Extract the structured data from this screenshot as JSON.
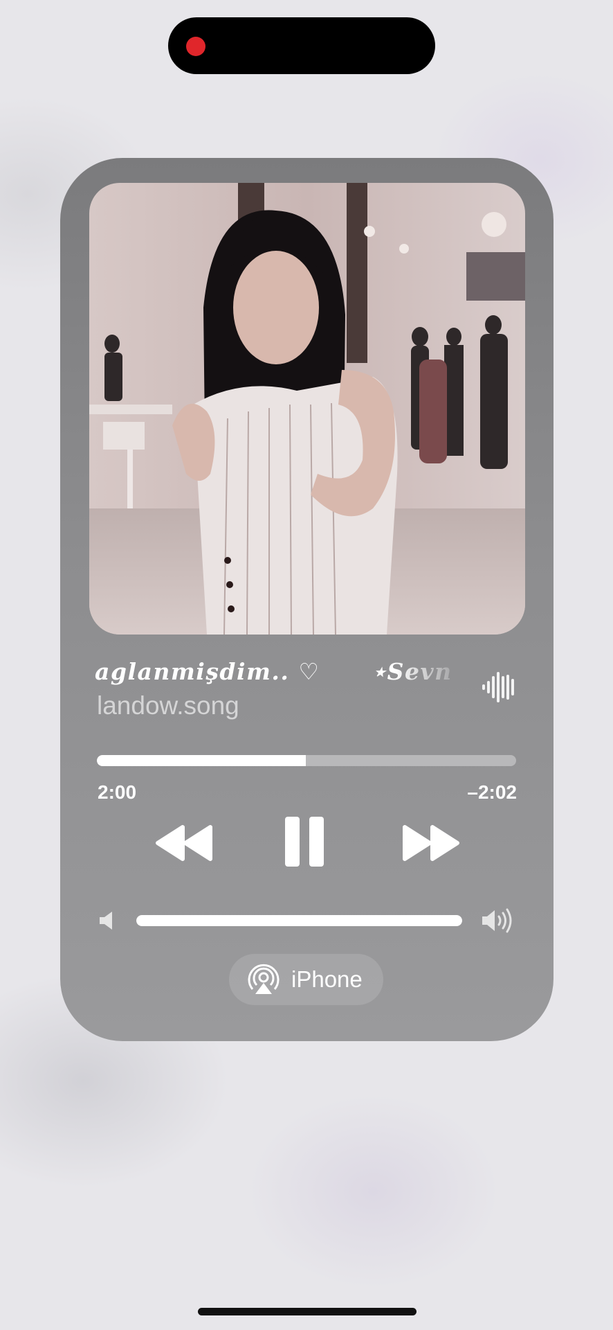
{
  "now_playing": {
    "title_primary": "aglanmişdim..",
    "title_heart": "♡",
    "title_secondary": "⋆Sevn",
    "artist": "landow.song",
    "artwork_icon": "music-video-artwork",
    "elapsed": "2:00",
    "remaining": "–2:02",
    "progress_fraction": 0.498,
    "is_playing": true
  },
  "controls": {
    "rewind_icon": "backward-icon",
    "pause_icon": "pause-icon",
    "forward_icon": "forward-icon"
  },
  "volume": {
    "level_fraction": 1.0,
    "low_icon": "speaker-low-icon",
    "high_icon": "speaker-high-icon"
  },
  "output": {
    "label": "iPhone",
    "icon": "airplay-icon"
  },
  "status": {
    "recording_indicator": "recording-dot"
  },
  "colors": {
    "recording": "#e0262b",
    "player_background": "#8a8a8c",
    "foreground": "#ffffff"
  }
}
